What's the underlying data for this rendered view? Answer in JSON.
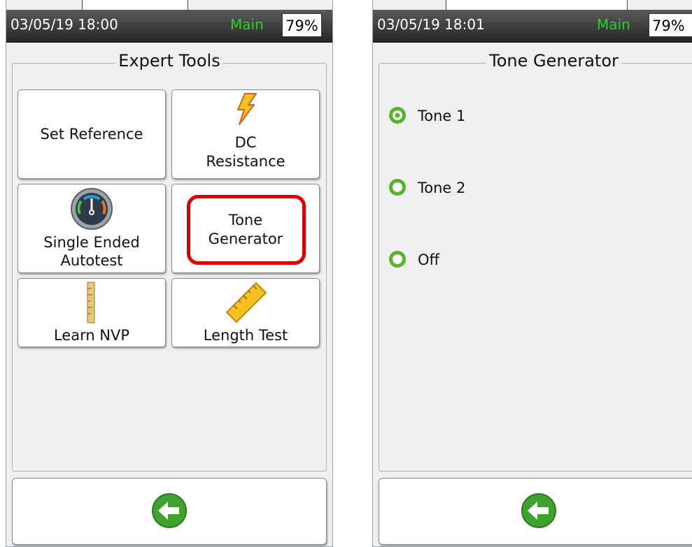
{
  "left_screen": {
    "status": {
      "datetime": "03/05/19 18:00",
      "mode": "Main",
      "battery": "79%"
    },
    "title": "Expert Tools",
    "tools": [
      {
        "label": "Set Reference",
        "icon": "none"
      },
      {
        "label_line1": "DC",
        "label_line2": "Resistance",
        "icon": "lightning-bolt-icon"
      },
      {
        "label_line1": "Single Ended",
        "label_line2": "Autotest",
        "icon": "gauge-icon"
      },
      {
        "label_line1": "Tone",
        "label_line2": "Generator",
        "icon": "none",
        "highlighted": true
      },
      {
        "label": "Learn NVP",
        "icon": "ruler-vertical-icon"
      },
      {
        "label": "Length Test",
        "icon": "ruler-diagonal-icon"
      }
    ],
    "highlight_color": "#e00000"
  },
  "right_screen": {
    "status": {
      "datetime": "03/05/19 18:01",
      "mode": "Main",
      "battery": "79%"
    },
    "title": "Tone Generator",
    "options": [
      {
        "label": "Tone 1",
        "selected": true
      },
      {
        "label": "Tone 2",
        "selected": false
      },
      {
        "label": "Off",
        "selected": false
      }
    ]
  },
  "colors": {
    "mode_green": "#27d327",
    "accent_green": "#55b22a",
    "back_green": "#3fa12e"
  },
  "icons": {
    "back": "back-arrow-icon"
  }
}
